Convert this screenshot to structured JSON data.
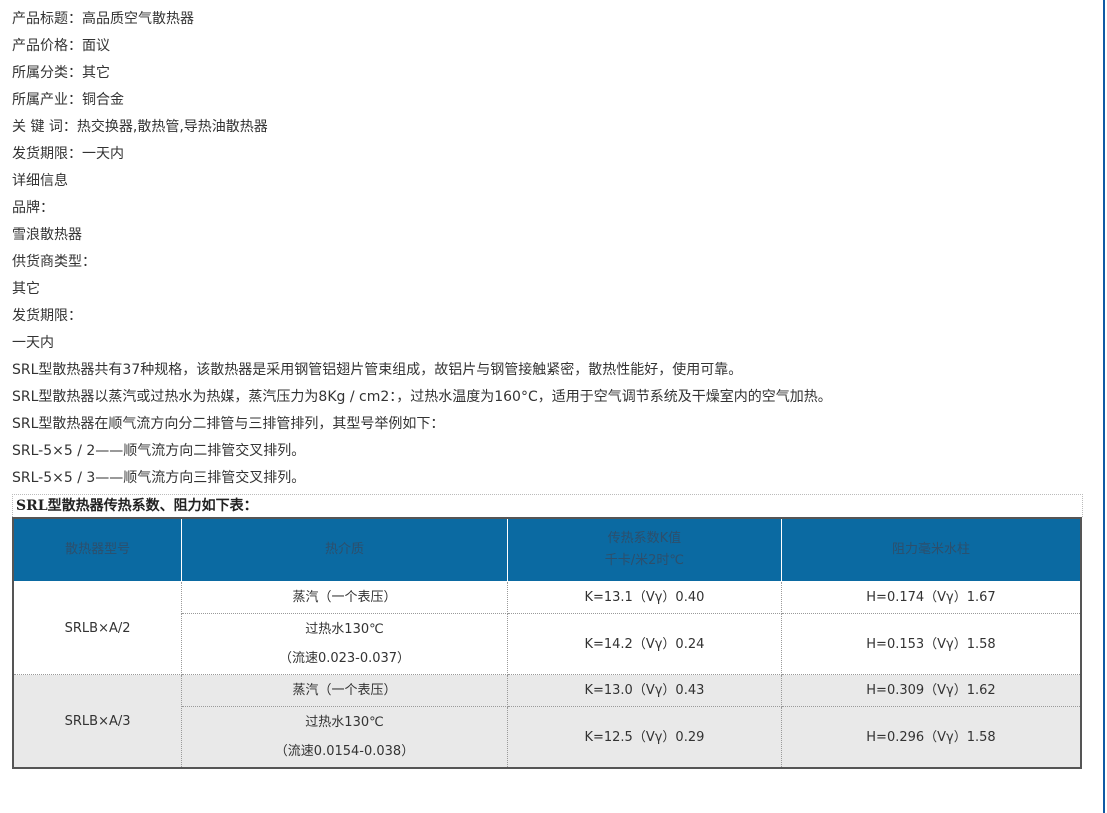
{
  "info_lines": [
    "产品标题：高品质空气散热器",
    "产品价格：面议",
    "所属分类：其它",
    "所属产业：铜合金",
    "关 键 词：热交换器,散热管,导热油散热器",
    "发货期限：一天内",
    "详细信息",
    "品牌：",
    "雪浪散热器",
    "供货商类型：",
    "其它",
    "发货期限：",
    "一天内",
    "SRL型散热器共有37种规格，该散热器是采用钢管铝翅片管束组成，故铝片与钢管接触紧密，散热性能好，使用可靠。",
    "SRL型散热器以蒸汽或过热水为热媒，蒸汽压力为8Kg / cm2：，过热水温度为160°C，适用于空气调节系统及干燥室内的空气加热。",
    "SRL型散热器在顺气流方向分二排管与三排管排列，其型号举例如下：",
    "SRL-5×5 / 2——顺气流方向二排管交叉排列。",
    "SRL-5×5 / 3——顺气流方向三排管交叉排列。"
  ],
  "table": {
    "title": "SRL型散热器传热系数、阻力如下表：",
    "headers": {
      "model": "散热器型号",
      "medium": "热介质",
      "k_line1": "传热系数K值",
      "k_line2": "千卡/米2时℃",
      "h": "阻力毫米水柱"
    },
    "groups": [
      {
        "model": "SRLB×A/2",
        "rows": [
          {
            "medium_line1": "蒸汽（一个表压）",
            "medium_line2": "",
            "k": "K=13.1（Vγ）0.40",
            "h": "H=0.174（Vγ）1.67"
          },
          {
            "medium_line1": "过热水130℃",
            "medium_line2": "（流速0.023-0.037）",
            "k": "K=14.2（Vγ）0.24",
            "h": "H=0.153（Vγ）1.58"
          }
        ]
      },
      {
        "model": "SRLB×A/3",
        "rows": [
          {
            "medium_line1": "蒸汽（一个表压）",
            "medium_line2": "",
            "k": "K=13.0（Vγ）0.43",
            "h": "H=0.309（Vγ）1.62"
          },
          {
            "medium_line1": "过热水130℃",
            "medium_line2": "（流速0.0154-0.038）",
            "k": "K=12.5（Vγ）0.29",
            "h": "H=0.296（Vγ）1.58"
          }
        ]
      }
    ]
  },
  "colors": {
    "header_bg": "#0b6aa2",
    "header_text": "#2d4f6c",
    "alt_row_bg": "#e9e9e9",
    "border_accent": "#0f5aa5"
  }
}
